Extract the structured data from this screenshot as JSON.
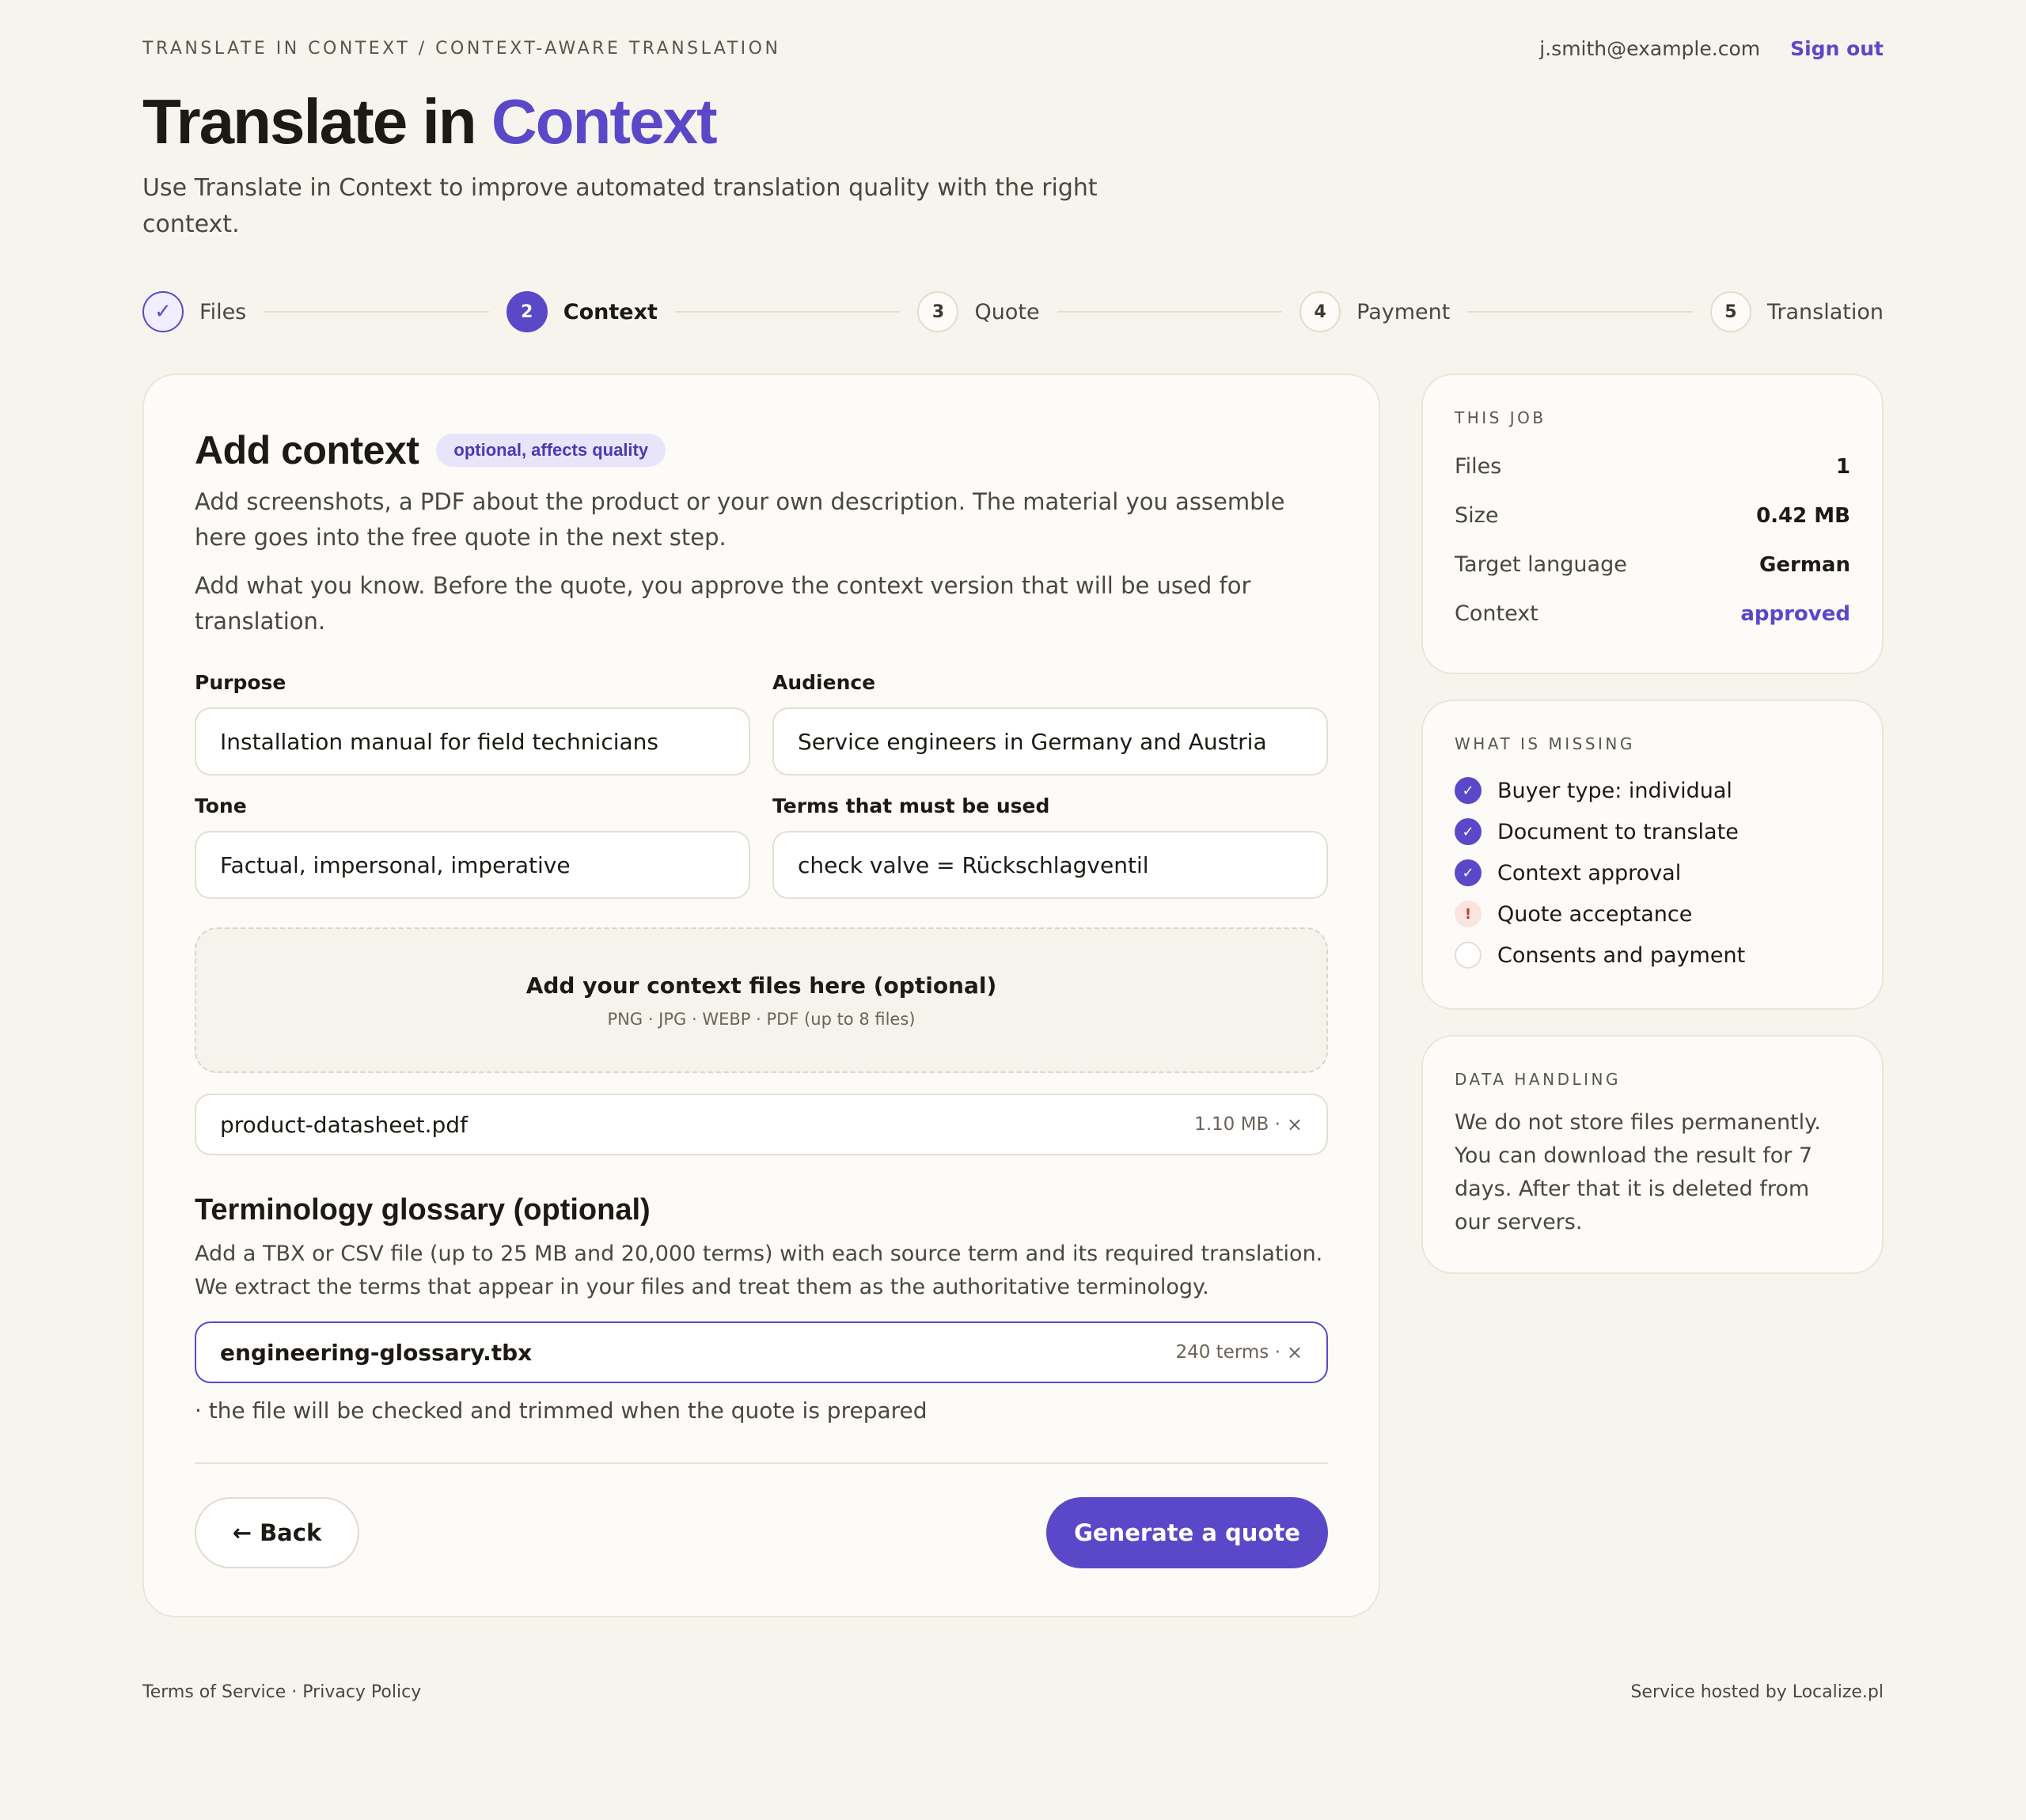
{
  "header": {
    "breadcrumb": "TRANSLATE IN CONTEXT / CONTEXT-AWARE TRANSLATION",
    "user_email": "j.smith@example.com",
    "sign_out": "Sign out"
  },
  "hero": {
    "title_part1": "Translate in ",
    "title_part2": "Context",
    "subtitle": "Use Translate in Context to improve automated translation quality with the right context."
  },
  "stepper": {
    "steps": [
      {
        "num": "✓",
        "label": "Files",
        "state": "done"
      },
      {
        "num": "2",
        "label": "Context",
        "state": "active"
      },
      {
        "num": "3",
        "label": "Quote",
        "state": "todo"
      },
      {
        "num": "4",
        "label": "Payment",
        "state": "todo"
      },
      {
        "num": "5",
        "label": "Translation",
        "state": "todo"
      }
    ]
  },
  "context_card": {
    "title": "Add context",
    "chip": "optional, affects quality",
    "desc1": "Add screenshots, a PDF about the product or your own description. The material you assemble here goes into the free quote in the next step.",
    "desc2": "Add what you know. Before the quote, you approve the context version that will be used for translation.",
    "fields": {
      "purpose": {
        "label": "Purpose",
        "value": "Installation manual for field technicians"
      },
      "audience": {
        "label": "Audience",
        "value": "Service engineers in Germany and Austria"
      },
      "tone": {
        "label": "Tone",
        "value": "Factual, impersonal, imperative"
      },
      "terms": {
        "label": "Terms that must be used",
        "value": "check valve = Rückschlagventil"
      }
    },
    "dropzone": {
      "title": "Add your context files here (optional)",
      "sub": "PNG · JPG · WEBP · PDF (up to 8 files)"
    },
    "context_file": {
      "name": "product-datasheet.pdf",
      "meta": "1.10 MB ·",
      "remove": "×"
    },
    "glossary": {
      "title": "Terminology glossary (optional)",
      "desc": "Add a TBX or CSV file (up to 25 MB and 20,000 terms) with each source term and its required translation. We extract the terms that appear in your files and treat them as the authoritative terminology.",
      "file": {
        "name": "engineering-glossary.tbx",
        "meta": "240 terms ·",
        "remove": "×"
      },
      "note": "· the file will be checked and trimmed when the quote is prepared"
    },
    "back_label": "Back",
    "back_arrow": "←",
    "primary_label": "Generate a quote"
  },
  "job": {
    "title": "THIS JOB",
    "rows": [
      {
        "key": "Files",
        "value": "1"
      },
      {
        "key": "Size",
        "value": "0.42 MB"
      },
      {
        "key": "Target language",
        "value": "German"
      },
      {
        "key": "Context",
        "value": "approved"
      }
    ]
  },
  "missing": {
    "title": "WHAT IS MISSING",
    "items": [
      {
        "label": "Buyer type: individual",
        "state": "done",
        "mark": "✓"
      },
      {
        "label": "Document to translate",
        "state": "done",
        "mark": "✓"
      },
      {
        "label": "Context approval",
        "state": "done",
        "mark": "✓"
      },
      {
        "label": "Quote acceptance",
        "state": "warn",
        "mark": "!"
      },
      {
        "label": "Consents and payment",
        "state": "todo",
        "mark": ""
      }
    ]
  },
  "data_handling": {
    "title": "DATA HANDLING",
    "text": "We do not store files permanently. You can download the result for 7 days. After that it is deleted from our servers."
  },
  "footer": {
    "terms": "Terms of Service",
    "sep": " · ",
    "privacy": "Privacy Policy",
    "hosted": "Service hosted by Localize.pl"
  },
  "colors": {
    "accent": "#5b48c8",
    "background": "#f7f4ee",
    "card": "#fdfbf7",
    "warn": "#c0392b"
  }
}
